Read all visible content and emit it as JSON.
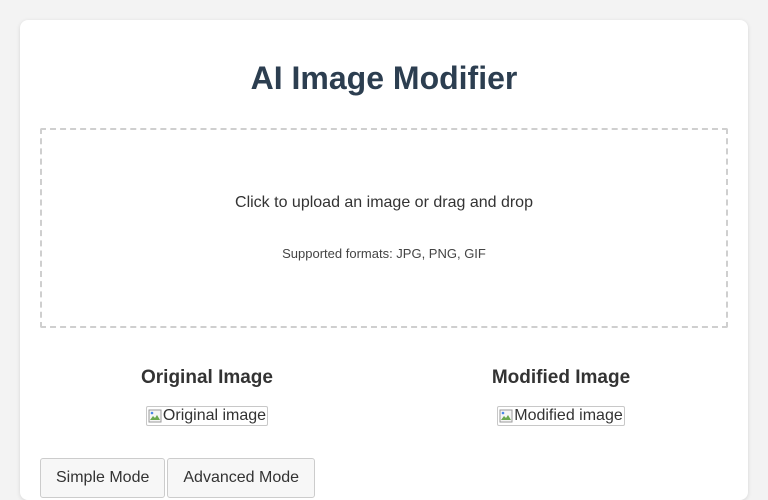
{
  "header": {
    "title": "AI Image Modifier"
  },
  "upload": {
    "prompt": "Click to upload an image or drag and drop",
    "formats": "Supported formats: JPG, PNG, GIF"
  },
  "original": {
    "heading": "Original Image",
    "alt": "Original image"
  },
  "modified": {
    "heading": "Modified Image",
    "alt": "Modified image"
  },
  "modes": [
    {
      "label": "Simple Mode"
    },
    {
      "label": "Advanced Mode"
    }
  ],
  "colors": {
    "title": "#2c3e50",
    "page_background": "#f3f3f3",
    "card_background": "#ffffff",
    "dropzone_border": "#cfcfcf"
  },
  "icons": {
    "broken_image": "broken-image-icon"
  }
}
